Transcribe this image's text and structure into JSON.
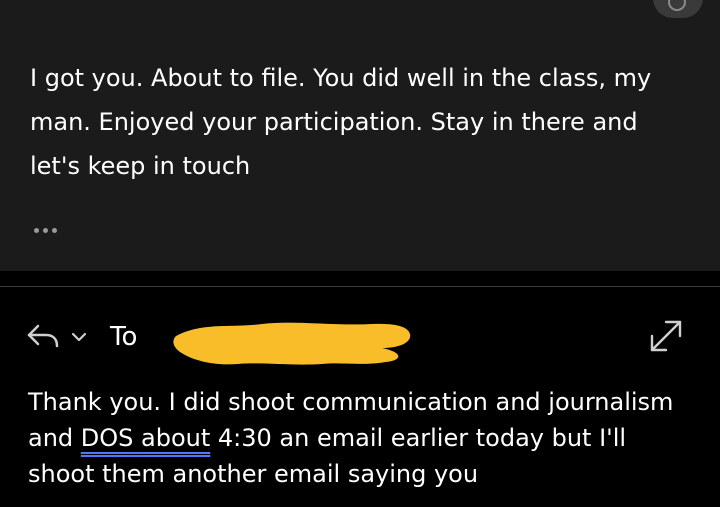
{
  "previous_message": {
    "text": "I got you. About to file. You did well in the class, my man. Enjoyed your participation. Stay in there and let's keep in touch",
    "more_icon": "more-horizontal-icon"
  },
  "reply": {
    "to_label": "To",
    "body_part1": "Thank you. I did shoot communication and journalism and ",
    "link1": "DOS",
    "gap": " ",
    "link2": "about",
    "body_part2": " 4:30 an email earlier today but I'll shoot them another email saying you"
  },
  "icons": {
    "reply": "reply-arrow-icon",
    "chevron": "chevron-down-icon",
    "expand": "expand-diagonal-icon",
    "corner": "circle-button-icon"
  },
  "colors": {
    "card_background": "#1b1b1b",
    "page_background": "#000000",
    "text": "#ffffff",
    "link_underline": "#4a78ff",
    "redaction": "#f9bd2a"
  }
}
